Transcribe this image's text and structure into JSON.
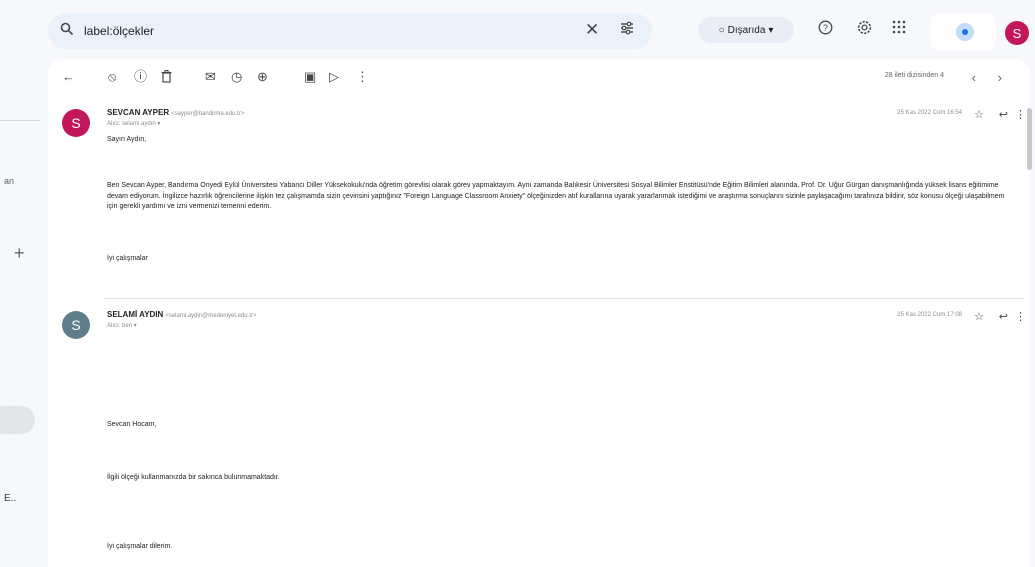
{
  "sidebar": {
    "partial_text_1": "an",
    "partial_text_2": "E..",
    "plus_label": "+"
  },
  "search": {
    "icon": "search-icon",
    "query": "label:ölçekler",
    "clear": "✕",
    "filter": "⚙"
  },
  "header": {
    "status_label": "Dışarıda",
    "status_dot": "○",
    "status_caret": "▾",
    "help": "?",
    "settings": "⚙",
    "apps": "⋮⋮⋮",
    "account_initial": "S"
  },
  "toolbar": {
    "back": "←",
    "report_spam": "⦸",
    "info": "ⓘ",
    "delete": "🗑",
    "mark_unread": "✉",
    "snooze": "◷",
    "add_task": "⊕",
    "move": "▣",
    "label": "▷",
    "more": "⋮",
    "pager_text": "28 ileti dizisinden 4",
    "prev": "‹",
    "next": "›"
  },
  "messages": [
    {
      "avatar": "S",
      "avatar_color": "#c2185b",
      "sender": "SEVCAN AYPER",
      "email": "<sayper@bandirma.edu.tr>",
      "to": "Alıcı: selami aydın ▾",
      "date": "25 Kas 2022 Cum 16:54",
      "star": "☆",
      "reply": "↩",
      "more": "⋮",
      "greeting": "Sayın Aydın,",
      "paragraph": "Ben Sevcan Ayper, Bandırma Onyedi Eylül Üniversitesi Yabancı Diller Yüksekokulu'nda öğretim görevlisi olarak görev yapmaktayım. Aynı zamanda Balıkesir Üniversitesi Sosyal Bilimler Enstitüsü'nde Eğitim Bilimleri alanında, Prof. Dr. Uğur Gürgan danışmanlığında yüksek lisans eğitimime devam ediyorum. İngilizce hazırlık öğrencilerine ilişkin tez çalışmamda sizin çevirisini yaptığınız \"Foreign Language Classroom Anxiety\" ölçeğinizden atıf kurallarına uyarak yararlanmak istediğimi ve araştırma sonuçlarını sizinle paylaşacağımı tarafınıza bildirir, söz konusu ölçeği ulaşabilmem için gerekli yardımı ve izni vermenizi temenni ederim.",
      "signoff": "İyi çalışmalar"
    },
    {
      "avatar": "S",
      "avatar_color": "#607d8b",
      "sender": "SELAMİ AYDIN",
      "email": "<selami.aydin@medeniyet.edu.tr>",
      "to": "Alıcı: ben ▾",
      "date": "25 Kas 2022 Cum 17:08",
      "star": "☆",
      "reply": "↩",
      "more": "⋮",
      "greeting": "Sevcan Hocam,",
      "line2": "İlgili ölçeği kullanmanızda bir sakınca bulunmamaktadır.",
      "line3": "İyi çalışmalar dilerim."
    }
  ]
}
